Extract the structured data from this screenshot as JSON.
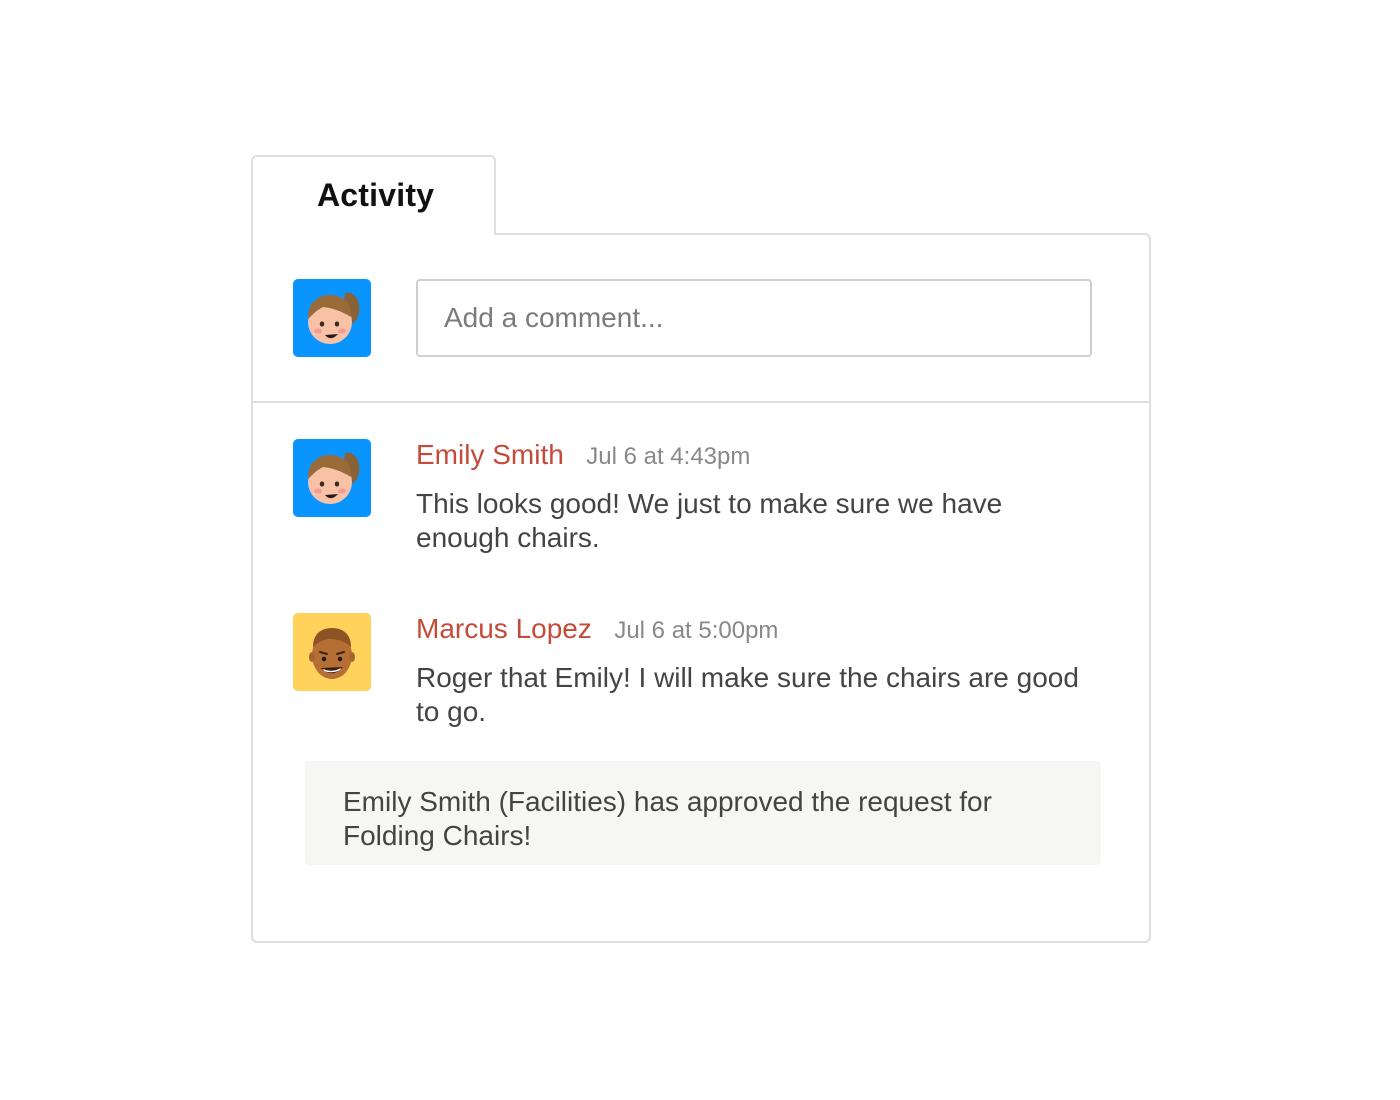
{
  "tabs": [
    {
      "label": "Activity"
    }
  ],
  "composer": {
    "placeholder": "Add a comment...",
    "avatar_icon": "female-avatar-icon",
    "avatar_bg": "#0a94ff"
  },
  "comments": [
    {
      "author": "Emily Smith",
      "time": "Jul 6 at 4:43pm",
      "text": "This looks good! We just to make sure we have enough chairs.",
      "avatar_icon": "female-avatar-icon",
      "avatar_bg": "#0a94ff"
    },
    {
      "author": "Marcus Lopez",
      "time": "Jul 6 at 5:00pm",
      "text": "Roger that Emily! I will make sure the chairs are good to go.",
      "avatar_icon": "male-avatar-icon",
      "avatar_bg": "#ffd25c"
    }
  ],
  "notice": {
    "text": "Emily Smith (Facilities) has approved the request for Folding Chairs!"
  },
  "colors": {
    "author_name": "#c64a3a",
    "timestamp": "#888888",
    "border": "#dedede",
    "notice_bg": "#f6f6f5"
  }
}
